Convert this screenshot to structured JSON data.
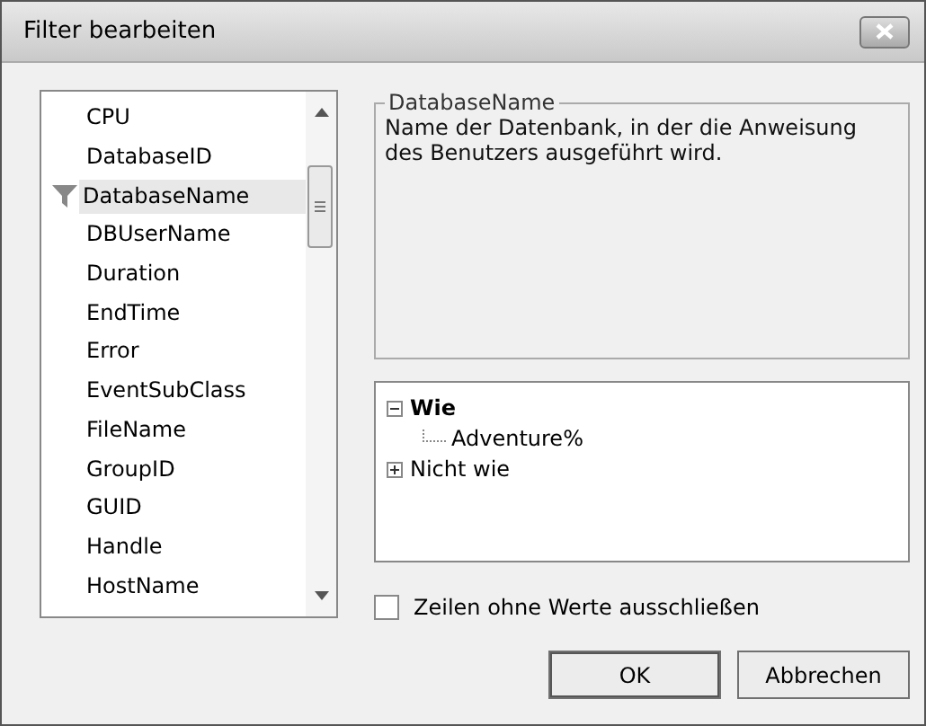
{
  "window": {
    "title": "Filter bearbeiten"
  },
  "columns": [
    {
      "name": "CPU",
      "selected": false,
      "filtered": false
    },
    {
      "name": "DatabaseID",
      "selected": false,
      "filtered": false
    },
    {
      "name": "DatabaseName",
      "selected": true,
      "filtered": true
    },
    {
      "name": "DBUserName",
      "selected": false,
      "filtered": false
    },
    {
      "name": "Duration",
      "selected": false,
      "filtered": false
    },
    {
      "name": "EndTime",
      "selected": false,
      "filtered": false
    },
    {
      "name": "Error",
      "selected": false,
      "filtered": false
    },
    {
      "name": "EventSubClass",
      "selected": false,
      "filtered": false
    },
    {
      "name": "FileName",
      "selected": false,
      "filtered": false
    },
    {
      "name": "GroupID",
      "selected": false,
      "filtered": false
    },
    {
      "name": "GUID",
      "selected": false,
      "filtered": false
    },
    {
      "name": "Handle",
      "selected": false,
      "filtered": false
    },
    {
      "name": "HostName",
      "selected": false,
      "filtered": false
    }
  ],
  "description": {
    "title": "DatabaseName",
    "text": "Name der Datenbank, in der die Anweisung des Benutzers ausgeführt wird."
  },
  "conditions": [
    {
      "label": "Wie",
      "expanded": true,
      "children": [
        {
          "label": "Adventure%"
        }
      ]
    },
    {
      "label": "Nicht wie",
      "expanded": false
    }
  ],
  "exclude_empty": {
    "label": "Zeilen ohne Werte ausschließen",
    "checked": false
  },
  "buttons": [
    "OK",
    "Abbrechen"
  ]
}
